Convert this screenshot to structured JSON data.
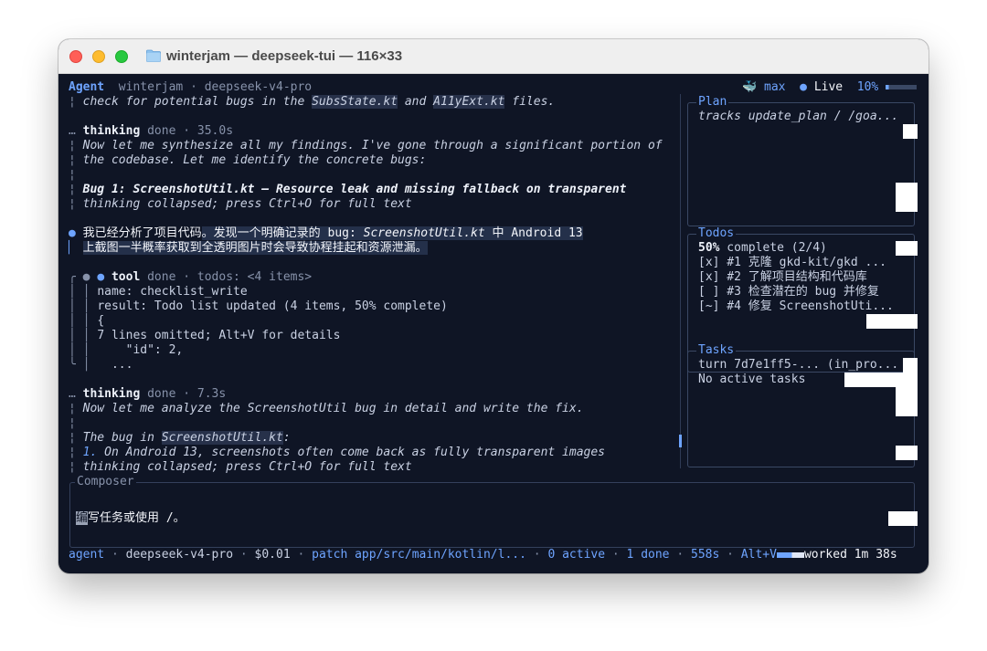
{
  "window": {
    "title": "winterjam — deepseek-tui — 116×33"
  },
  "header": {
    "mode": "Agent",
    "project": "winterjam",
    "model": "deepseek-v4-pro",
    "effort": "max",
    "live": "Live",
    "context_pct": "10%"
  },
  "transcript": {
    "l1": "check for potential bugs in the ",
    "l1_file1": "SubsState.kt",
    "l1_and": " and ",
    "l1_file2": "A11yExt.kt",
    "l1_end": " files.",
    "thinking1_label": "thinking",
    "thinking1_meta": "done · 35.0s",
    "t1_a": "Now let me synthesize all my findings. I've gone through a significant portion of",
    "t1_b": "the codebase. Let me identify the concrete bugs:",
    "bug1": "Bug 1: ScreenshotUtil.kt — Resource leak and missing fallback on transparent",
    "collapsed1": "thinking collapsed; press Ctrl+O for full text",
    "msg_a1": "我已经分析了项目代码",
    "msg_a2": "。发现一个明确记录的 bug: ",
    "msg_a3": "ScreenshotUtil.kt",
    "msg_a4": " 中 Android 13",
    "msg_b": "上截图一半概率获取到全透明图片时会导致协程挂起和资源泄漏。",
    "tool_label": "tool",
    "tool_meta": "done · todos: <4 items>",
    "tool_name": "name: checklist_write",
    "tool_result": "result: Todo list updated (4 items, 50% complete)",
    "tool_brace": "{",
    "tool_omitted": "7 lines omitted; Alt+V for details",
    "tool_id": "    \"id\": 2,",
    "tool_dots": "...",
    "thinking2_label": "thinking",
    "thinking2_meta": "done · 7.3s",
    "t2_a": "Now let me analyze the ScreenshotUtil bug in detail and write the fix.",
    "t2_b1": "The bug in ",
    "t2_b2": "ScreenshotUtil.kt",
    "t2_b3": ":",
    "t2_c1": "1.",
    "t2_c2": " On Android 13, screenshots often come back as fully transparent images",
    "collapsed2": "thinking collapsed; press Ctrl+O for full text"
  },
  "plan": {
    "title": "Plan",
    "text": "tracks update_plan / /goa..."
  },
  "todos": {
    "title": "Todos",
    "pct": "50%",
    "summary": " complete (2/4)",
    "items": [
      "[x] #1 克隆 gkd-kit/gkd ...",
      "[x] #2 了解项目结构和代码库",
      "[ ] #3 检查潜在的 bug 并修复",
      "[~] #4 修复 ScreenshotUti..."
    ]
  },
  "tasks": {
    "title": "Tasks",
    "turn": "turn 7d7e1ff5-... (in_pro...",
    "none": "No active tasks"
  },
  "composer": {
    "title": "Composer",
    "cursor_char": "编",
    "placeholder": "写任务或使用 /。"
  },
  "status": {
    "mode": "agent",
    "model": "deepseek-v4-pro",
    "cost": "$0.01",
    "patch": "patch app/src/main/kotlin/l...",
    "active": "0 active",
    "done": "1 done",
    "elapsed": "558s",
    "altv": "Alt+V",
    "worked": "worked 1m 38s"
  },
  "colors": {
    "terminal_bg": "#0f1525",
    "accent_blue": "#6ea4ff",
    "accent_orange": "#f0a24a",
    "selection": "#24304a"
  }
}
